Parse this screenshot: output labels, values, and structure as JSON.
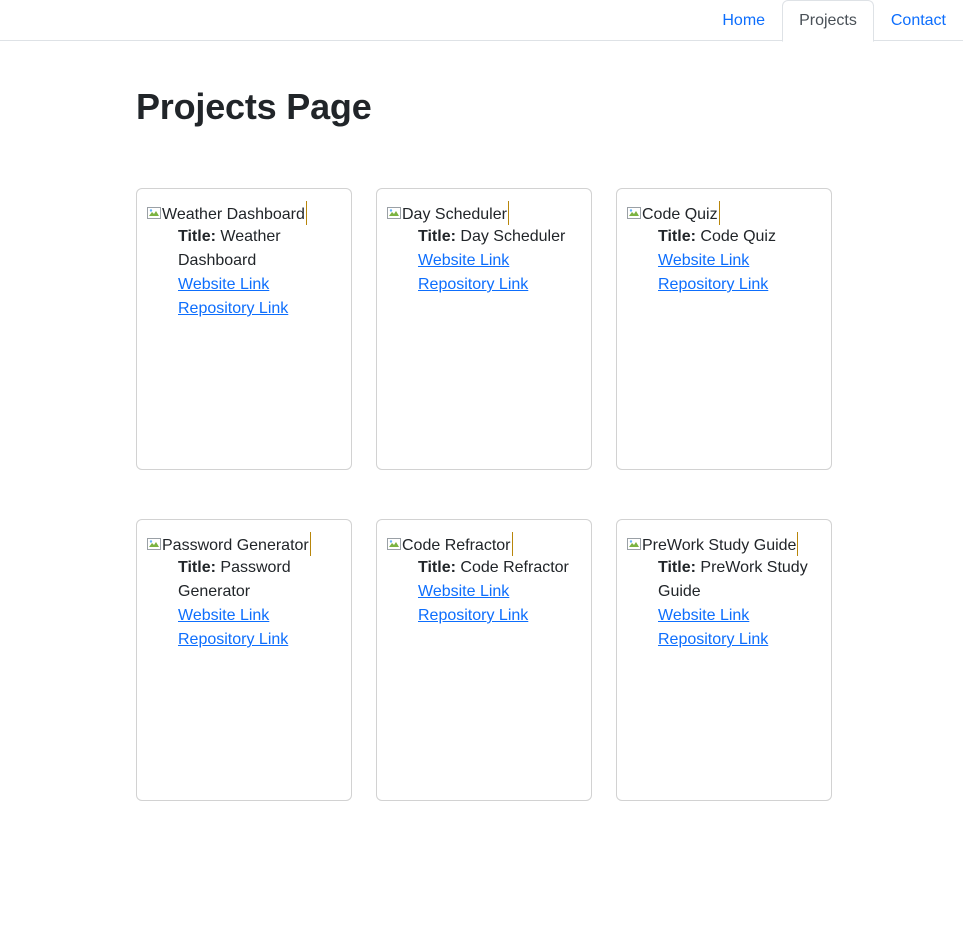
{
  "nav": {
    "tabs": [
      {
        "label": "Home",
        "active": false
      },
      {
        "label": "Projects",
        "active": true
      },
      {
        "label": "Contact",
        "active": false
      }
    ]
  },
  "page": {
    "title": "Projects Page"
  },
  "title_prefix": "Title:",
  "projects": [
    {
      "img_alt": "Weather Dashboard",
      "title": "Weather Dashboard",
      "website_label": "Website Link",
      "repo_label": "Repository Link"
    },
    {
      "img_alt": "Day Scheduler",
      "title": "Day Scheduler",
      "website_label": "Website Link",
      "repo_label": "Repository Link"
    },
    {
      "img_alt": "Code Quiz",
      "title": "Code Quiz",
      "website_label": "Website Link",
      "repo_label": "Repository Link"
    },
    {
      "img_alt": "Password Generator",
      "title": "Password Generator",
      "website_label": "Website Link",
      "repo_label": "Repository Link"
    },
    {
      "img_alt": "Code Refractor",
      "title": "Code Refractor",
      "website_label": "Website Link",
      "repo_label": "Repository Link"
    },
    {
      "img_alt": "PreWork Study Guide",
      "title": "PreWork Study Guide",
      "website_label": "Website Link",
      "repo_label": "Repository Link"
    }
  ],
  "colors": {
    "link": "#0d6efd",
    "text": "#212529",
    "border": "#dee2e6"
  }
}
